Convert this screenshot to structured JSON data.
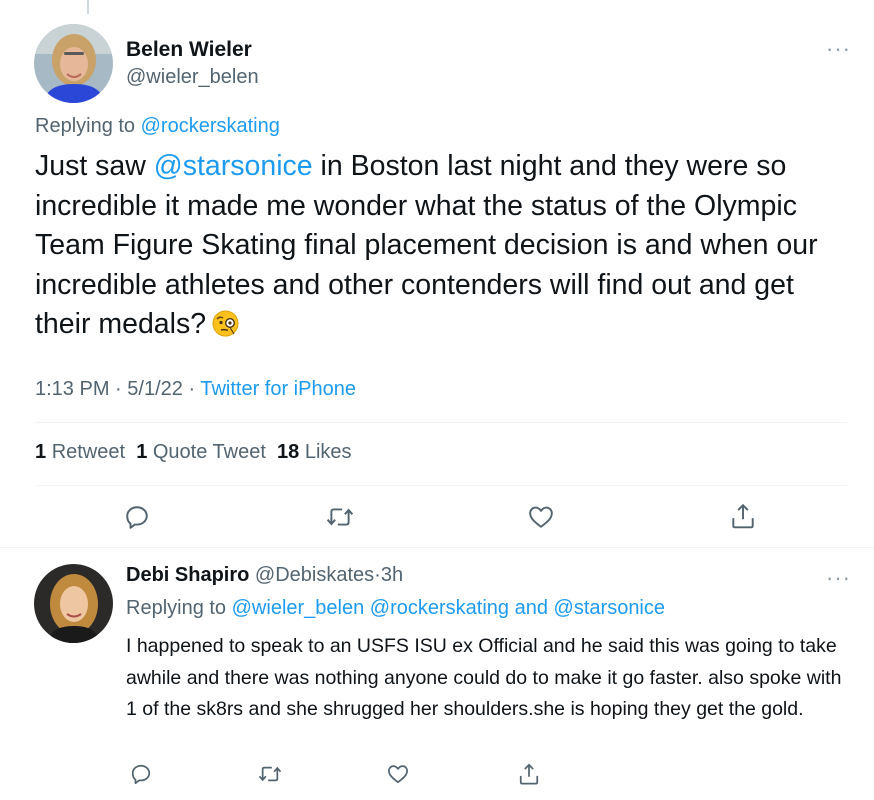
{
  "main_tweet": {
    "author_name": "Belen Wieler",
    "author_handle": "@wieler_belen",
    "replying_prefix": "Replying to",
    "replying_to": "@rockerskating",
    "text_before": "Just saw",
    "text_mention": "@starsonice",
    "text_after": "in Boston last night and they were so incredible it made me wonder what the status of the Olympic Team Figure Skating final placement decision is and when our incredible athletes and other contenders will find out and get their medals?",
    "emoji": "monocle-face",
    "time": "1:13 PM",
    "date": "5/1/22",
    "source": "Twitter for iPhone",
    "separator": "·",
    "stats": {
      "retweets_count": "1",
      "retweets_label": "Retweet",
      "quotes_count": "1",
      "quotes_label": "Quote Tweet",
      "likes_count": "18",
      "likes_label": "Likes"
    },
    "actions": [
      "reply-icon",
      "retweet-icon",
      "like-icon",
      "share-icon"
    ]
  },
  "reply_tweet": {
    "author_name": "Debi Shapiro",
    "author_handle": "@Debiskates",
    "separator": "·",
    "age": "3h",
    "replying_prefix": "Replying to",
    "replying_to_1": "@wieler_belen",
    "replying_to_2": "@rockerskating",
    "replying_and": "and",
    "replying_to_3": "@starsonice",
    "text": "I happened to speak to an USFS ISU ex Official and he said this was going to take awhile and there was nothing anyone could do to make it go faster. also spoke with 1 of the sk8rs and she shrugged her shoulders.she is hoping they get the gold.",
    "actions": [
      "reply-icon",
      "retweet-icon",
      "like-icon",
      "share-icon"
    ]
  },
  "colors": {
    "link": "#1d9bf0",
    "secondary_text": "#536471",
    "primary_text": "#0f1419",
    "divider": "#eff3f4"
  }
}
